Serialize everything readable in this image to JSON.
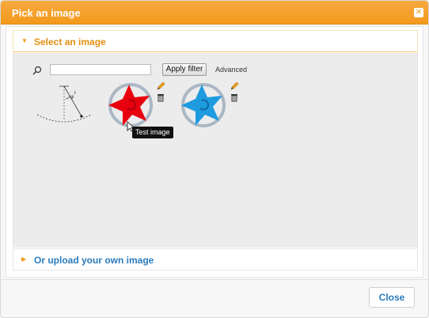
{
  "dialog": {
    "title": "Pick an image",
    "close_icon": "close-icon",
    "accent_color": "#f39a1c",
    "link_color": "#2a7bbd"
  },
  "select_section": {
    "label": "Select an image",
    "state": "expanded",
    "filter": {
      "search_icon": "search-icon",
      "input_value": "",
      "apply_label": "Apply filter",
      "advanced_label": "Advanced"
    },
    "images": [
      {
        "name": "pendulum sketch",
        "has_tools": false
      },
      {
        "name": "red star",
        "tooltip": "Test image",
        "has_tools": true
      },
      {
        "name": "blue star",
        "has_tools": true
      }
    ],
    "tooltip": "Test image"
  },
  "upload_section": {
    "label": "Or upload your own image",
    "state": "collapsed"
  },
  "footer": {
    "close_label": "Close"
  }
}
